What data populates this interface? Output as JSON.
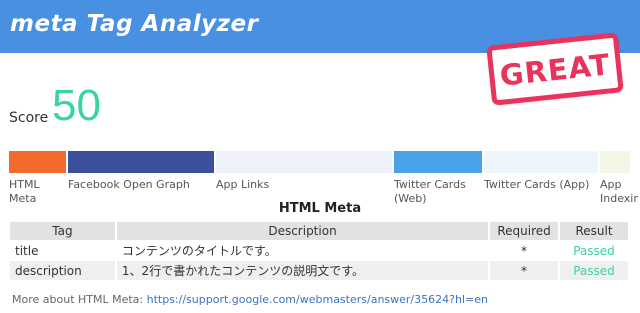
{
  "header": {
    "title": "meta Tag Analyzer",
    "color": "#4a90e2"
  },
  "stamp": {
    "text": "GREAT",
    "color": "#e8335d"
  },
  "score": {
    "label": "Score",
    "value": "50",
    "color": "#3bd2a4"
  },
  "categories": [
    {
      "label": "HTML Meta",
      "color": "#f26a2c"
    },
    {
      "label": "Facebook Open Graph",
      "color": "#3b4f9c"
    },
    {
      "label": "App Links",
      "color": "#eef0fb"
    },
    {
      "label": "Twitter Cards (Web)",
      "color": "#4aa3e8"
    },
    {
      "label": "Twitter Cards (App)",
      "color": "#eef6fd"
    },
    {
      "label": "App Indexing",
      "color": "#f3f8e6"
    }
  ],
  "section": {
    "title": "HTML Meta"
  },
  "table": {
    "headers": [
      "Tag",
      "Description",
      "Required",
      "Result"
    ],
    "rows": [
      [
        "title",
        "コンテンツのタイトルです。",
        "*",
        "Passed"
      ],
      [
        "description",
        "1、2行で書かれたコンテンツの説明文です。",
        "*",
        "Passed"
      ]
    ]
  },
  "footer": {
    "prefix": "More about HTML Meta:",
    "link": "https://support.google.com/webmasters/answer/35624?hl=en"
  }
}
